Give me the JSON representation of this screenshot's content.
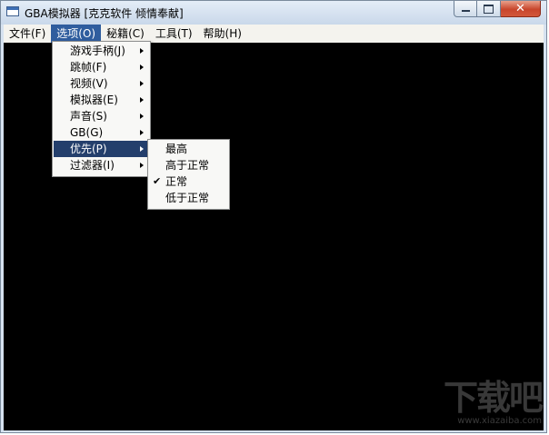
{
  "window": {
    "title": "GBA模拟器 [克克软件 倾情奉献]",
    "controls": {
      "minimize": "minimize",
      "maximize": "maximize",
      "close": "✕"
    }
  },
  "menubar": [
    {
      "label": "文件(F)"
    },
    {
      "label": "选项(O)",
      "active": true
    },
    {
      "label": "秘籍(C)"
    },
    {
      "label": "工具(T)"
    },
    {
      "label": "帮助(H)"
    }
  ],
  "options_menu": [
    {
      "label": "游戏手柄(J)",
      "submenu": true
    },
    {
      "label": "跳帧(F)",
      "submenu": true
    },
    {
      "label": "视频(V)",
      "submenu": true
    },
    {
      "label": "模拟器(E)",
      "submenu": true
    },
    {
      "label": "声音(S)",
      "submenu": true
    },
    {
      "label": "GB(G)",
      "submenu": true
    },
    {
      "label": "优先(P)",
      "submenu": true,
      "highlighted": true
    },
    {
      "label": "过滤器(I)",
      "submenu": true
    }
  ],
  "priority_submenu": [
    {
      "label": "最高",
      "checked": false
    },
    {
      "label": "高于正常",
      "checked": false
    },
    {
      "label": "正常",
      "checked": true
    },
    {
      "label": "低于正常",
      "checked": false
    }
  ],
  "check_glyph": "✔",
  "watermark": {
    "logo": "下载吧",
    "url": "www.xiazaiba.com"
  }
}
